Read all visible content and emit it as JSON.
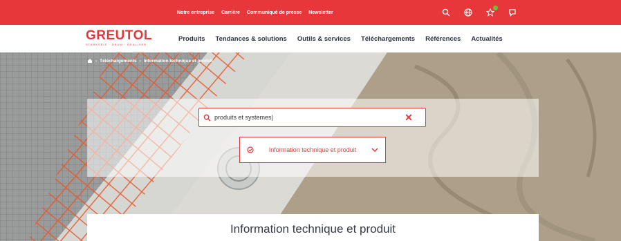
{
  "topbar": {
    "links": [
      "Notre entreprise",
      "Carrière",
      "Communiqué de presse",
      "Newsletter"
    ],
    "icons": [
      "search-icon",
      "globe-icon",
      "star-icon",
      "chat-icon"
    ],
    "accent": "#e8373a",
    "badge_color": "#6bbf3a"
  },
  "brand": {
    "name": "GREUTOL",
    "tagline": "STARKSEIS · DRUM · REALISER"
  },
  "nav": {
    "items": [
      "Produits",
      "Tendances & solutions",
      "Outils & services",
      "Téléchargements",
      "Références",
      "Actualités"
    ]
  },
  "breadcrumb": {
    "home_icon": "home-icon",
    "items": [
      "Téléchargements",
      "Information technique et produit"
    ]
  },
  "search": {
    "value": "produits et systemes|",
    "placeholder": "produits et systemes"
  },
  "filter": {
    "label": "Information technique et produit"
  },
  "content": {
    "title": "Information technique et produit"
  }
}
